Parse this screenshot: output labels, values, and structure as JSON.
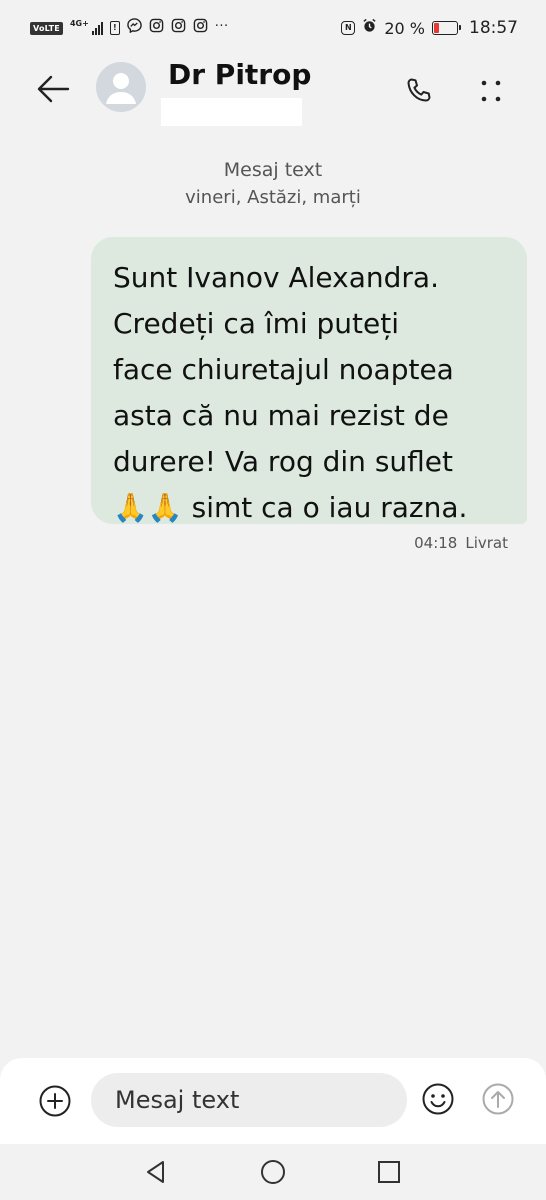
{
  "status_bar": {
    "volte": "VoLTE",
    "network_type": "4G+",
    "notification_icons": [
      "sim-alert-icon",
      "messenger-icon",
      "instagram-icon",
      "instagram-icon",
      "instagram-icon"
    ],
    "more_notifications": "···",
    "battery_percent": "20 %",
    "battery_level": 0.2,
    "time": "18:57"
  },
  "header": {
    "contact_name": "Dr Pitrop",
    "back_icon": "arrow-left-icon",
    "call_icon": "phone-icon",
    "more_icon": "more-vertical-icon"
  },
  "conversation": {
    "type_label": "Mesaj text",
    "dates": "vineri, Astăzi, marți"
  },
  "message": {
    "text": "Sunt Ivanov Alexandra.\nCredeți ca îmi puteți\nface chiuretajul noaptea\nasta că nu mai rezist de\ndurere! Va rog din suflet\n🙏🙏 simt ca o iau razna.",
    "time": "04:18",
    "status": "Livrat",
    "bubble_color": "#dde9df"
  },
  "composer": {
    "placeholder": "Mesaj text",
    "value": ""
  },
  "colors": {
    "background": "#f2f2f2",
    "battery_low": "#e53935"
  }
}
